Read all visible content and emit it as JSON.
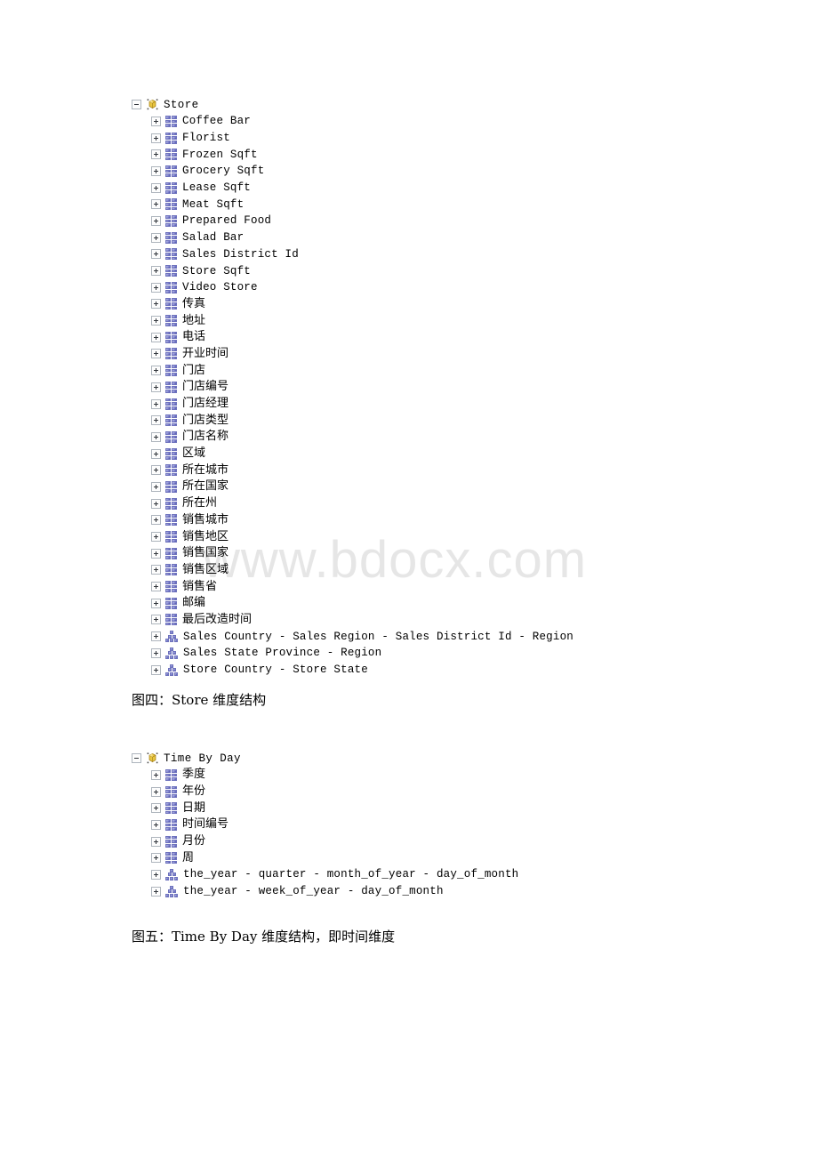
{
  "watermark": {
    "text": "www.bdocx.com"
  },
  "figures": [
    {
      "id": "store",
      "root": {
        "label": "Store",
        "icon": "dimension-cube-icon",
        "expander": "minus"
      },
      "attributes": [
        "Coffee Bar",
        "Florist",
        "Frozen Sqft",
        "Grocery Sqft",
        "Lease Sqft",
        "Meat Sqft",
        "Prepared Food",
        "Salad Bar",
        "Sales District Id",
        "Store Sqft",
        "Video Store",
        "传真",
        "地址",
        "电话",
        "开业时间",
        "门店",
        "门店编号",
        "门店经理",
        "门店类型",
        "门店名称",
        "区域",
        "所在城市",
        "所在国家",
        "所在州",
        "销售城市",
        "销售地区",
        "销售国家",
        "销售区域",
        "销售省",
        "邮编",
        "最后改造时间"
      ],
      "hierarchies": [
        "Sales Country - Sales Region - Sales District Id - Region",
        "Sales State Province - Region",
        "Store Country - Store State"
      ],
      "caption": "图四：Store 维度结构"
    },
    {
      "id": "time-by-day",
      "root": {
        "label": "Time By Day",
        "icon": "dimension-cube-icon",
        "expander": "minus"
      },
      "attributes": [
        "季度",
        "年份",
        "日期",
        "时间编号",
        "月份",
        "周"
      ],
      "hierarchies": [
        "the_year -  quarter -  month_of_year -  day_of_month",
        "the_year -  week_of_year -  day_of_month"
      ],
      "caption": "图五：Time By Day 维度结构，即时间维度"
    }
  ],
  "colors": {
    "attribute_icon": "#4a4fa8",
    "hierarchy_icon": "#4b50a9",
    "dimension_icon": "#e8c23a",
    "watermark": "#e6e6e6",
    "expander_border": "#aeb5bd"
  }
}
